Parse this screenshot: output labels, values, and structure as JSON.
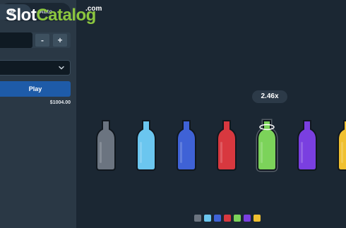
{
  "tabs": {
    "manual_label": "al",
    "auto_label": "Auto"
  },
  "bet": {
    "minus_label": "-",
    "plus_label": "+"
  },
  "play_label": "Play",
  "balance": "$1004.00",
  "multiplier": "2.46x",
  "logo": {
    "part1": "Slot",
    "part2": "Catalog",
    "suffix": ".com"
  },
  "bottles": [
    {
      "color": "#6b7480",
      "selected": false
    },
    {
      "color": "#6bc6ef",
      "selected": false
    },
    {
      "color": "#3f62d6",
      "selected": false
    },
    {
      "color": "#d8383f",
      "selected": false
    },
    {
      "color": "#7cd35a",
      "selected": true
    },
    {
      "color": "#7a3fe0",
      "selected": false
    },
    {
      "color": "#f0c030",
      "selected": false
    }
  ],
  "color_dots": [
    "#6b7480",
    "#6bc6ef",
    "#3f62d6",
    "#d8383f",
    "#7cd35a",
    "#7a3fe0",
    "#f0c030"
  ]
}
